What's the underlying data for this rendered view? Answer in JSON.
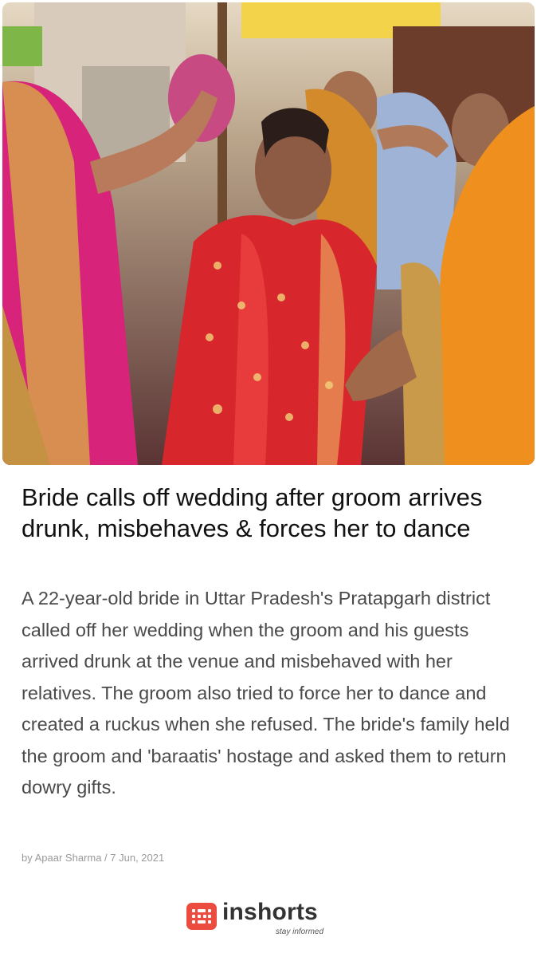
{
  "article": {
    "image_alt": "Bride in red saree surrounded by women at a wedding",
    "headline": "Bride calls off wedding after groom arrives drunk, misbehaves & forces her to dance",
    "body": "A 22-year-old bride in Uttar Pradesh's Pratapgarh district called off her wedding when the groom and his guests arrived drunk at the venue and misbehaved with her relatives. The groom also tried to force her to dance and created a ruckus when she refused. The bride's family held the groom and 'baraatis' hostage and asked them to return dowry gifts.",
    "byline": "by Apaar Sharma / 7 Jun, 2021"
  },
  "brand": {
    "name": "inshorts",
    "tagline": "stay informed",
    "icon": "inshorts-logo-icon",
    "accent_color": "#ec4b3f"
  }
}
